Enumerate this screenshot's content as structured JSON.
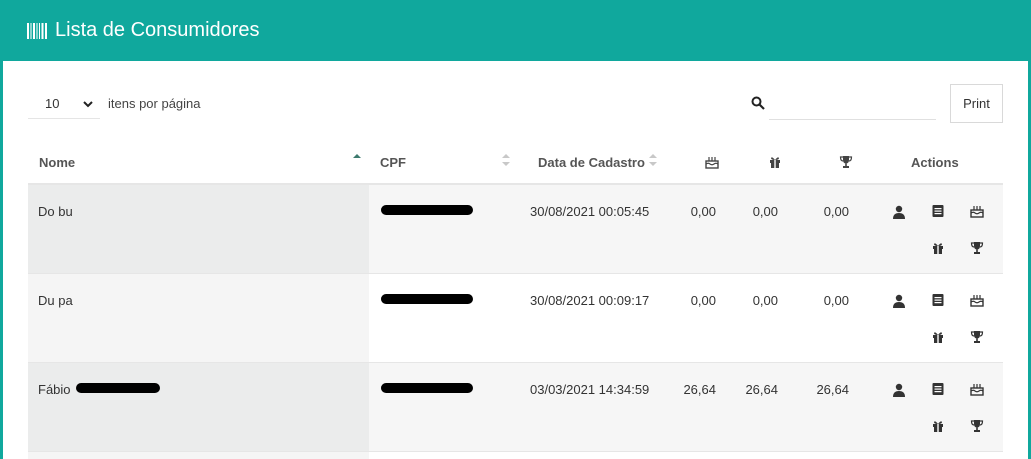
{
  "header": {
    "title": "Lista de Consumidores",
    "icon": "barcode-icon",
    "color": "#10a89d"
  },
  "controls": {
    "page_length": "10",
    "page_length_label": "itens por página",
    "search_value": "",
    "print_label": "Print"
  },
  "table": {
    "columns": {
      "nome": "Nome",
      "cpf": "CPF",
      "data_cadastro": "Data de Cadastro",
      "col4_icon": "cake-icon",
      "col5_icon": "gift-icon",
      "col6_icon": "trophy-icon",
      "actions": "Actions"
    },
    "sorted_by": "Nome",
    "rows": [
      {
        "nome": "Do bu",
        "cpf": "",
        "data_cadastro": "30/08/2021 00:05:45",
        "v1": "0,00",
        "v2": "0,00",
        "v3": "0,00"
      },
      {
        "nome": "Du pa",
        "cpf": "",
        "data_cadastro": "30/08/2021 00:09:17",
        "v1": "0,00",
        "v2": "0,00",
        "v3": "0,00"
      },
      {
        "nome": "Fábio",
        "cpf": "",
        "data_cadastro": "03/03/2021 14:34:59",
        "v1": "26,64",
        "v2": "26,64",
        "v3": "26,64"
      }
    ],
    "row_actions": [
      "user-icon",
      "list-icon",
      "cake-icon",
      "gift-icon",
      "trophy-icon"
    ]
  }
}
